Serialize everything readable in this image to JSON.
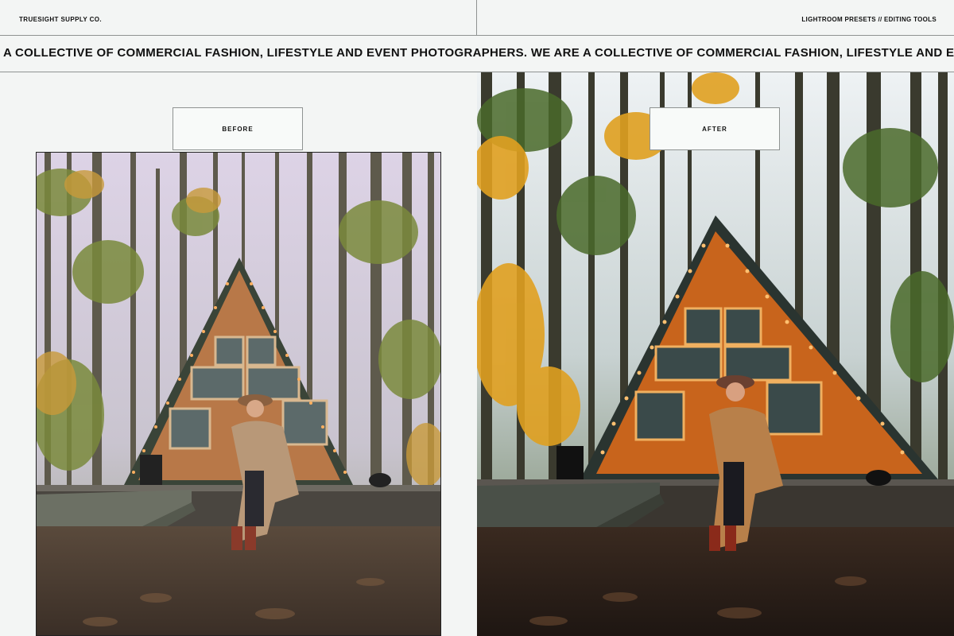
{
  "header": {
    "brand": "TRUESIGHT SUPPLY CO.",
    "tools": "LIGHTROOM PRESETS // EDITING TOOLS"
  },
  "ticker": {
    "text": "A COLLECTIVE OF COMMERCIAL FASHION, LIFESTYLE AND EVENT PHOTOGRAPHERS. WE ARE A COLLECTIVE OF COMMERCIAL FASHION, LIFESTYLE AND EVENT PHOTOGRAPHERS."
  },
  "comparison": {
    "before_label": "BEFORE",
    "after_label": "AFTER"
  },
  "colors": {
    "background": "#f3f5f4",
    "border": "#8f9392",
    "before_sky": "#d9cfe3",
    "after_sky": "#e8eef2",
    "before_wood": "#b87848",
    "after_wood": "#c8641c"
  },
  "icons": {
    "before_photo": "photo-icon",
    "after_photo": "photo-icon"
  }
}
